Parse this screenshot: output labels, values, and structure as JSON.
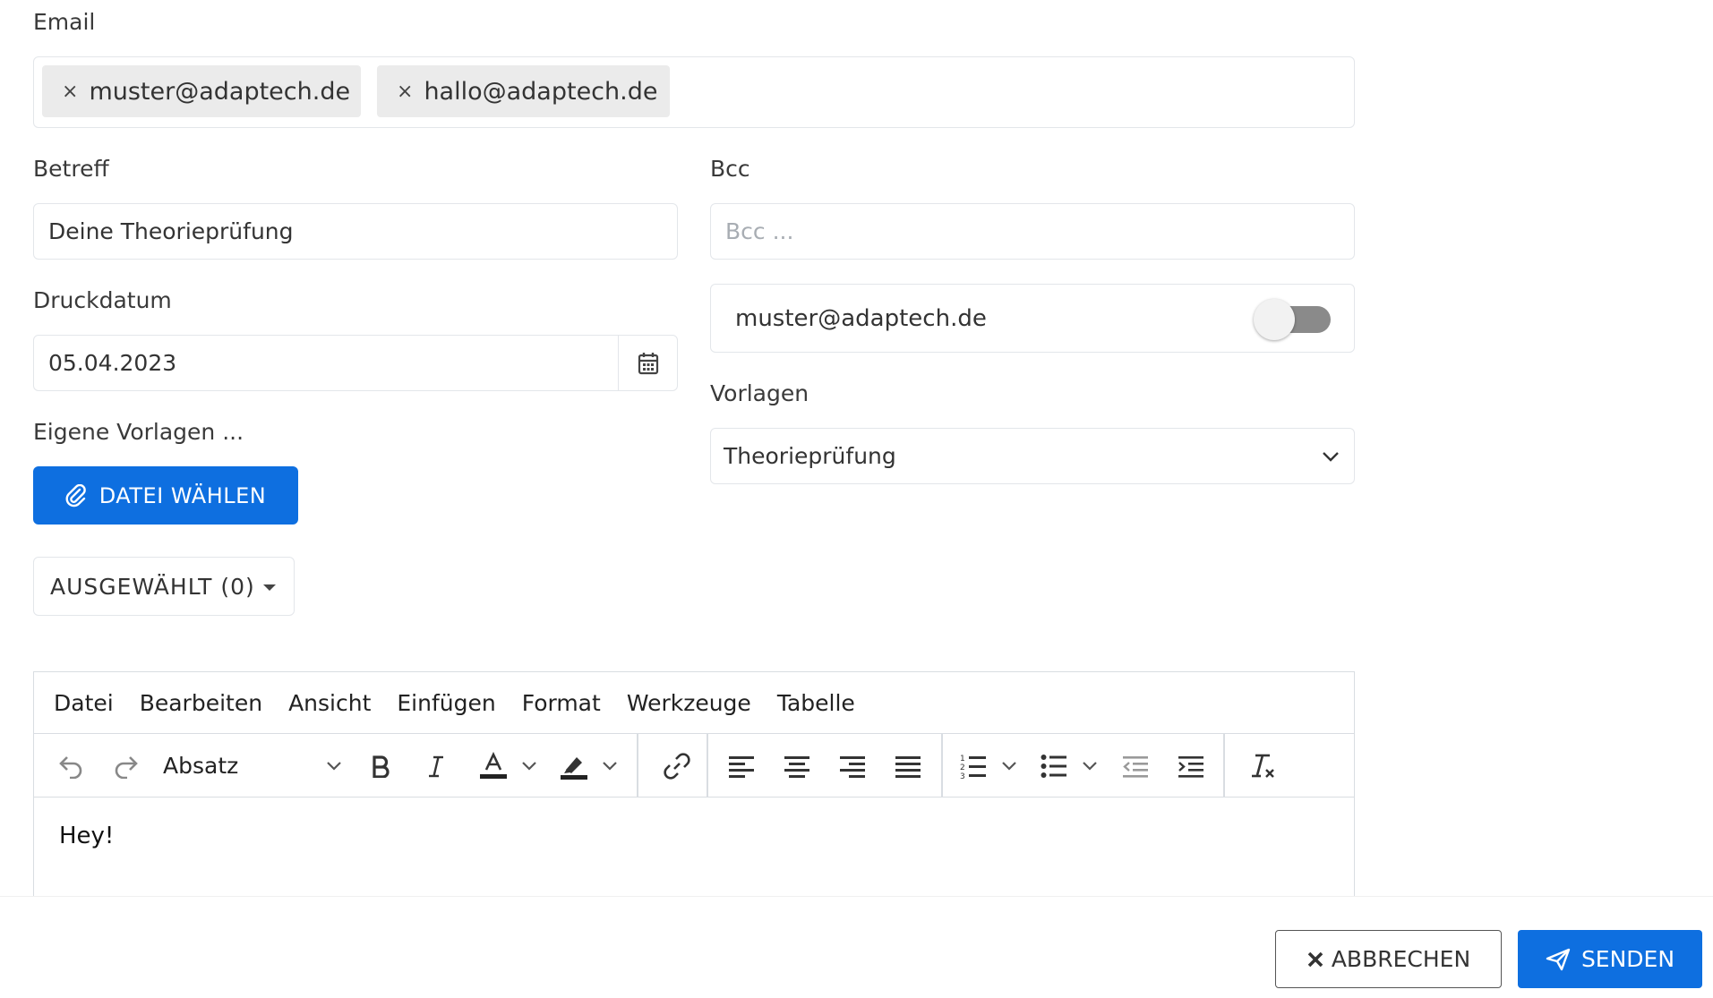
{
  "email": {
    "label": "Email",
    "chips": [
      {
        "remove_glyph": "×",
        "address": "muster@adaptech.de"
      },
      {
        "remove_glyph": "×",
        "address": "hallo@adaptech.de"
      }
    ]
  },
  "betreff": {
    "label": "Betreff",
    "value": "Deine Theorieprüfung"
  },
  "bcc": {
    "label": "Bcc",
    "placeholder": "Bcc ..."
  },
  "druckdatum": {
    "label": "Druckdatum",
    "value": "05.04.2023"
  },
  "self_copy": {
    "address": "muster@adaptech.de",
    "enabled": false
  },
  "vorlagen": {
    "label": "Vorlagen",
    "selected": "Theorieprüfung"
  },
  "eigene_vorlagen": {
    "label": "Eigene Vorlagen ...",
    "file_button": "DATEI WÄHLEN"
  },
  "selected_dropdown": {
    "label": "AUSGEWÄHLT (0)"
  },
  "editor": {
    "menu": [
      "Datei",
      "Bearbeiten",
      "Ansicht",
      "Einfügen",
      "Format",
      "Werkzeuge",
      "Tabelle"
    ],
    "block_format": "Absatz",
    "content": "Hey!"
  },
  "footer": {
    "cancel_label": "ABBRECHEN",
    "send_label": "SENDEN"
  },
  "colors": {
    "primary": "#0e6fe0",
    "border": "#e3e6ea",
    "chip_bg": "#ebebeb"
  }
}
